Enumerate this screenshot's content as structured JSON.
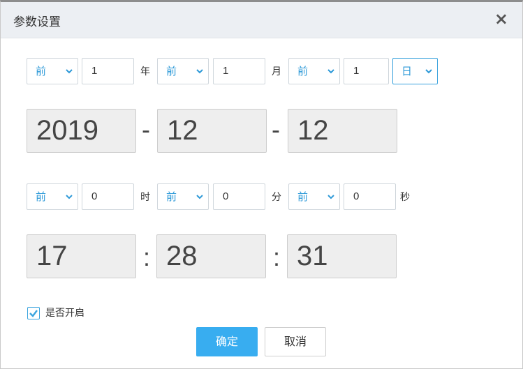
{
  "dialog": {
    "title": "参数设置",
    "close": "×"
  },
  "date_offset": {
    "year": {
      "dir": "前",
      "value": "1",
      "unit": "年"
    },
    "month": {
      "dir": "前",
      "value": "1",
      "unit": "月"
    },
    "day": {
      "dir": "前",
      "value": "1",
      "unit": "日"
    }
  },
  "date_display": {
    "year": "2019",
    "month": "12",
    "day": "12",
    "sep": "-"
  },
  "time_offset": {
    "hour": {
      "dir": "前",
      "value": "0",
      "unit": "时"
    },
    "minute": {
      "dir": "前",
      "value": "0",
      "unit": "分"
    },
    "second": {
      "dir": "前",
      "value": "0",
      "unit": "秒"
    }
  },
  "time_display": {
    "hour": "17",
    "minute": "28",
    "second": "31",
    "sep": ":"
  },
  "enable": {
    "label": "是否开启",
    "checked": true
  },
  "buttons": {
    "ok": "确定",
    "cancel": "取消"
  },
  "colors": {
    "accent": "#38adf0",
    "select_text": "#2e9ad8",
    "display_bg": "#eeeeee"
  }
}
